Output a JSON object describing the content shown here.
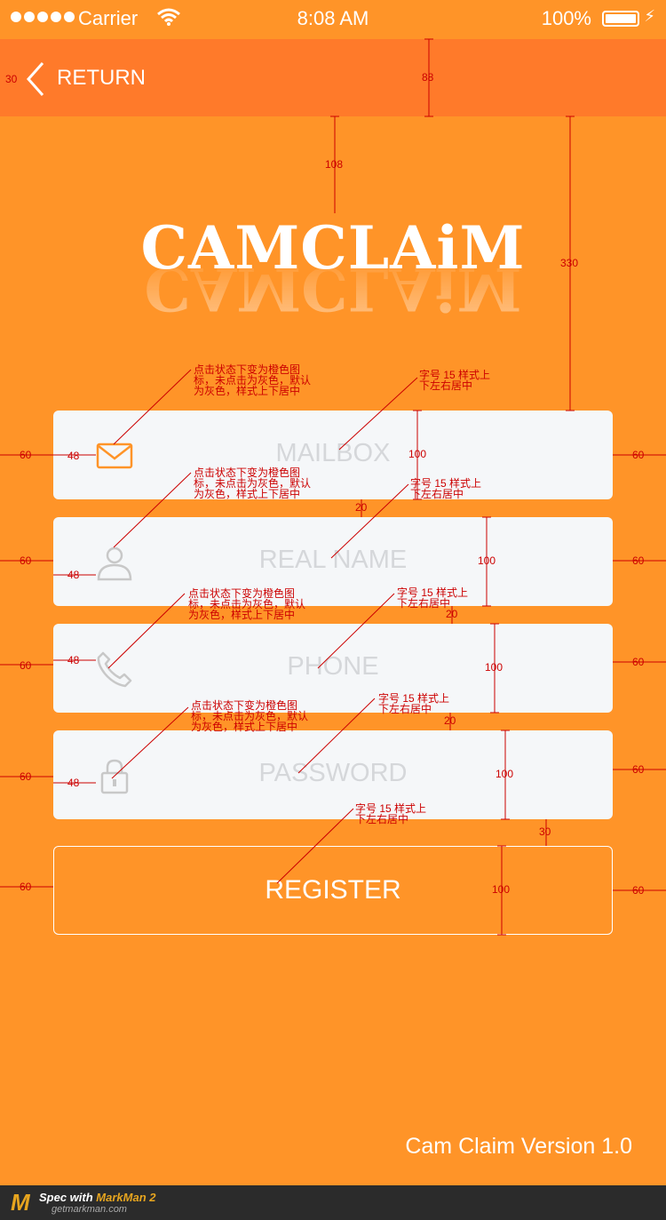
{
  "status_bar": {
    "carrier": "Carrier",
    "time": "8:08 AM",
    "battery": "100%"
  },
  "nav": {
    "return_label": "RETURN"
  },
  "logo_text": "CAMCLAiM",
  "fields": [
    {
      "label": "MAILBOX",
      "icon": "mail-icon"
    },
    {
      "label": "REAL NAME",
      "icon": "user-icon"
    },
    {
      "label": "PHONE",
      "icon": "phone-icon"
    },
    {
      "label": "PASSWORD",
      "icon": "lock-icon"
    }
  ],
  "register_label": "REGISTER",
  "version": "Cam Claim Version 1.0",
  "footer": {
    "brand": "M",
    "spec_prefix": "Spec with ",
    "spec_brand": "MarkMan 2",
    "site": "getmarkman.com"
  },
  "annotations": {
    "icon_note": "点击状态下变为橙色图标，未点击为灰色，默认为灰色，样式上下居中",
    "text_note": "字号 15 样式上下左右居中"
  },
  "measurements": {
    "nav_left": "30",
    "nav_height": "88",
    "logo_top": "108",
    "form_top": "330",
    "side": "60",
    "icon_left": "48",
    "field_height": "100",
    "gap": "20",
    "register_gap": "30"
  },
  "colors": {
    "background": "#ff9428",
    "navbar": "#ff7a2a",
    "field_bg": "#f5f7f9",
    "placeholder": "#d5d7da",
    "annotation": "#cc0000"
  }
}
